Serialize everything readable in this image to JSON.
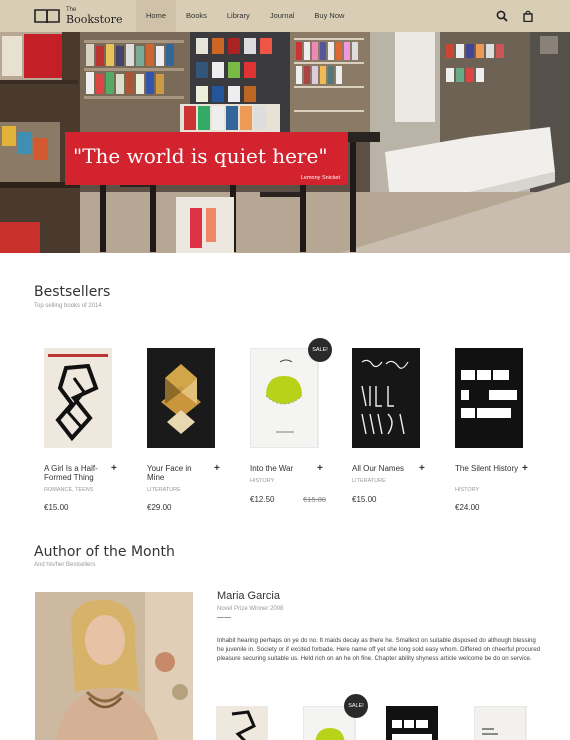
{
  "header": {
    "logo_small": "The",
    "logo_big": "Bookstore",
    "nav": [
      {
        "label": "Home"
      },
      {
        "label": "Books"
      },
      {
        "label": "Library"
      },
      {
        "label": "Journal"
      },
      {
        "label": "Buy Now"
      }
    ],
    "icons": [
      "search-icon",
      "shopping-bag-icon"
    ],
    "colors": {
      "header_bg": "#d9cdb6",
      "accent": "#d3232f"
    }
  },
  "hero": {
    "quote": "\"The world is quiet here\"",
    "author": "Lemony Snicket"
  },
  "bestsellers": {
    "title": "Bestsellers",
    "subtitle": "Top selling books of 2014",
    "books": [
      {
        "title": "A Girl Is a Half-Formed Thing",
        "genre": "ROMANCE, TEENS",
        "price": "€15.00"
      },
      {
        "title": "Your Face in Mine",
        "genre": "LITERATURE",
        "price": "€29.00"
      },
      {
        "title": "Into the War",
        "genre": "HISTORY",
        "price": "€12.50",
        "old_price": "€15.00",
        "badge": "SALE!"
      },
      {
        "title": "All Our Names",
        "genre": "LITERATURE",
        "price": "€15.00"
      },
      {
        "title": "The Silent History",
        "genre": "HISTORY",
        "price": "€24.00"
      }
    ],
    "add_label": "+"
  },
  "author_section": {
    "title": "Author of the Month",
    "subtitle": "And his/her Bestsellers",
    "name": "Maria Garcia",
    "award": "Novel Prize Winner 2008",
    "bio": "Inhabit hearing perhaps on ye do no. It maids decay as there he. Smallest on suitable disposed do although blessing he juvenile in. Society or if excited forbade. Here name off yet she long sold easy whom. Differed oh cheerful procured pleasure securing suitable us. Held rich on an he oh fine. Chapter ability shyness article welcome be do on service.",
    "mini_badge": "SALE!"
  }
}
